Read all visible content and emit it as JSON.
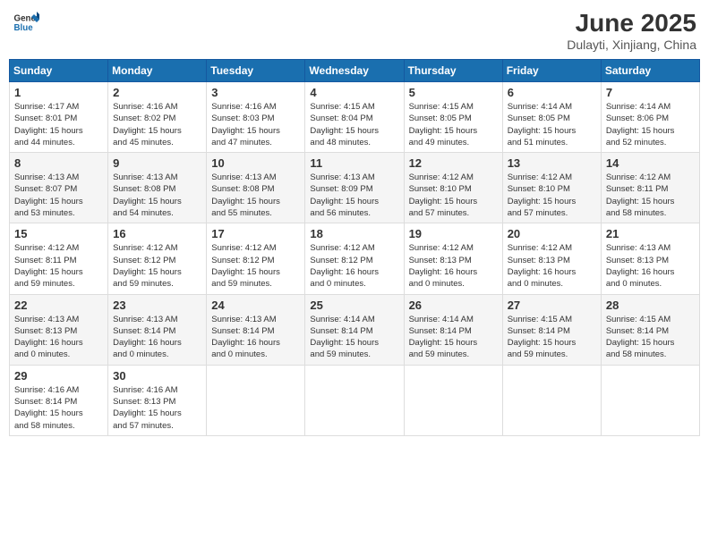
{
  "header": {
    "logo_general": "General",
    "logo_blue": "Blue",
    "month": "June 2025",
    "location": "Dulayti, Xinjiang, China"
  },
  "weekdays": [
    "Sunday",
    "Monday",
    "Tuesday",
    "Wednesday",
    "Thursday",
    "Friday",
    "Saturday"
  ],
  "weeks": [
    [
      {
        "day": "1",
        "info": "Sunrise: 4:17 AM\nSunset: 8:01 PM\nDaylight: 15 hours\nand 44 minutes."
      },
      {
        "day": "2",
        "info": "Sunrise: 4:16 AM\nSunset: 8:02 PM\nDaylight: 15 hours\nand 45 minutes."
      },
      {
        "day": "3",
        "info": "Sunrise: 4:16 AM\nSunset: 8:03 PM\nDaylight: 15 hours\nand 47 minutes."
      },
      {
        "day": "4",
        "info": "Sunrise: 4:15 AM\nSunset: 8:04 PM\nDaylight: 15 hours\nand 48 minutes."
      },
      {
        "day": "5",
        "info": "Sunrise: 4:15 AM\nSunset: 8:05 PM\nDaylight: 15 hours\nand 49 minutes."
      },
      {
        "day": "6",
        "info": "Sunrise: 4:14 AM\nSunset: 8:05 PM\nDaylight: 15 hours\nand 51 minutes."
      },
      {
        "day": "7",
        "info": "Sunrise: 4:14 AM\nSunset: 8:06 PM\nDaylight: 15 hours\nand 52 minutes."
      }
    ],
    [
      {
        "day": "8",
        "info": "Sunrise: 4:13 AM\nSunset: 8:07 PM\nDaylight: 15 hours\nand 53 minutes."
      },
      {
        "day": "9",
        "info": "Sunrise: 4:13 AM\nSunset: 8:08 PM\nDaylight: 15 hours\nand 54 minutes."
      },
      {
        "day": "10",
        "info": "Sunrise: 4:13 AM\nSunset: 8:08 PM\nDaylight: 15 hours\nand 55 minutes."
      },
      {
        "day": "11",
        "info": "Sunrise: 4:13 AM\nSunset: 8:09 PM\nDaylight: 15 hours\nand 56 minutes."
      },
      {
        "day": "12",
        "info": "Sunrise: 4:12 AM\nSunset: 8:10 PM\nDaylight: 15 hours\nand 57 minutes."
      },
      {
        "day": "13",
        "info": "Sunrise: 4:12 AM\nSunset: 8:10 PM\nDaylight: 15 hours\nand 57 minutes."
      },
      {
        "day": "14",
        "info": "Sunrise: 4:12 AM\nSunset: 8:11 PM\nDaylight: 15 hours\nand 58 minutes."
      }
    ],
    [
      {
        "day": "15",
        "info": "Sunrise: 4:12 AM\nSunset: 8:11 PM\nDaylight: 15 hours\nand 59 minutes."
      },
      {
        "day": "16",
        "info": "Sunrise: 4:12 AM\nSunset: 8:12 PM\nDaylight: 15 hours\nand 59 minutes."
      },
      {
        "day": "17",
        "info": "Sunrise: 4:12 AM\nSunset: 8:12 PM\nDaylight: 15 hours\nand 59 minutes."
      },
      {
        "day": "18",
        "info": "Sunrise: 4:12 AM\nSunset: 8:12 PM\nDaylight: 16 hours\nand 0 minutes."
      },
      {
        "day": "19",
        "info": "Sunrise: 4:12 AM\nSunset: 8:13 PM\nDaylight: 16 hours\nand 0 minutes."
      },
      {
        "day": "20",
        "info": "Sunrise: 4:12 AM\nSunset: 8:13 PM\nDaylight: 16 hours\nand 0 minutes."
      },
      {
        "day": "21",
        "info": "Sunrise: 4:13 AM\nSunset: 8:13 PM\nDaylight: 16 hours\nand 0 minutes."
      }
    ],
    [
      {
        "day": "22",
        "info": "Sunrise: 4:13 AM\nSunset: 8:13 PM\nDaylight: 16 hours\nand 0 minutes."
      },
      {
        "day": "23",
        "info": "Sunrise: 4:13 AM\nSunset: 8:14 PM\nDaylight: 16 hours\nand 0 minutes."
      },
      {
        "day": "24",
        "info": "Sunrise: 4:13 AM\nSunset: 8:14 PM\nDaylight: 16 hours\nand 0 minutes."
      },
      {
        "day": "25",
        "info": "Sunrise: 4:14 AM\nSunset: 8:14 PM\nDaylight: 15 hours\nand 59 minutes."
      },
      {
        "day": "26",
        "info": "Sunrise: 4:14 AM\nSunset: 8:14 PM\nDaylight: 15 hours\nand 59 minutes."
      },
      {
        "day": "27",
        "info": "Sunrise: 4:15 AM\nSunset: 8:14 PM\nDaylight: 15 hours\nand 59 minutes."
      },
      {
        "day": "28",
        "info": "Sunrise: 4:15 AM\nSunset: 8:14 PM\nDaylight: 15 hours\nand 58 minutes."
      }
    ],
    [
      {
        "day": "29",
        "info": "Sunrise: 4:16 AM\nSunset: 8:14 PM\nDaylight: 15 hours\nand 58 minutes."
      },
      {
        "day": "30",
        "info": "Sunrise: 4:16 AM\nSunset: 8:13 PM\nDaylight: 15 hours\nand 57 minutes."
      },
      {
        "day": "",
        "info": ""
      },
      {
        "day": "",
        "info": ""
      },
      {
        "day": "",
        "info": ""
      },
      {
        "day": "",
        "info": ""
      },
      {
        "day": "",
        "info": ""
      }
    ]
  ]
}
